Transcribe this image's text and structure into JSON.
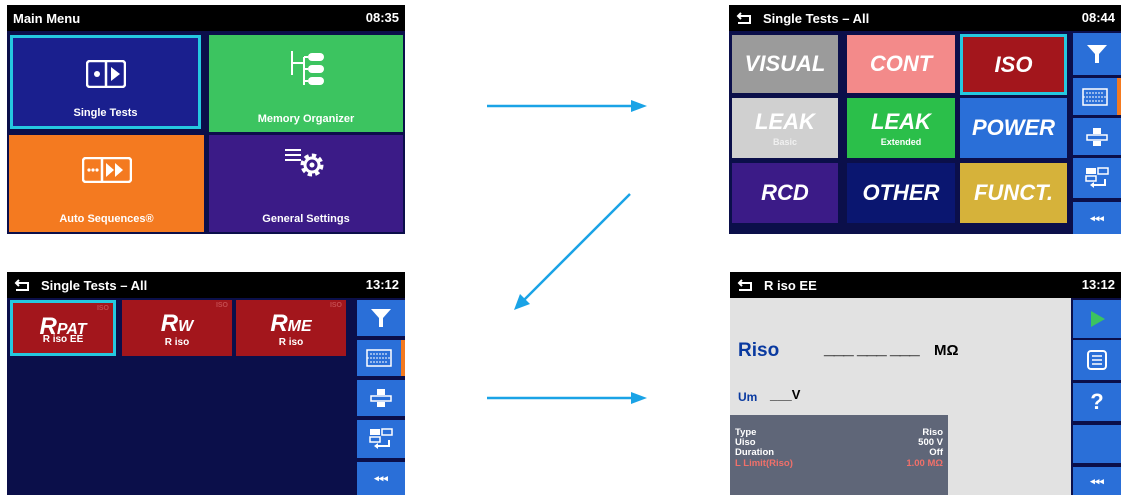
{
  "screen1": {
    "title": "Main Menu",
    "time": "08:35",
    "tiles": [
      {
        "label": "Single Tests",
        "icon": "single-tests-icon"
      },
      {
        "label": "Memory Organizer",
        "icon": "memory-organizer-icon"
      },
      {
        "label": "Auto Sequences®",
        "icon": "auto-sequences-icon"
      },
      {
        "label": "General Settings",
        "icon": "general-settings-icon"
      }
    ],
    "colors": {
      "single": "#1a1f8e",
      "memory": "#3cc460",
      "auto": "#f47a20",
      "settings": "#3b1b87",
      "selected": "#25c8e0"
    }
  },
  "screen2": {
    "title": "Single Tests – All",
    "time": "08:44",
    "tests": [
      {
        "label": "VISUAL",
        "sub": "",
        "color": "#9b9b9b"
      },
      {
        "label": "CONT",
        "sub": "",
        "color": "#f38a8a"
      },
      {
        "label": "ISO",
        "sub": "",
        "color": "#a3161c"
      },
      {
        "label": "LEAK",
        "sub": "Basic",
        "color": "#d0d0d0"
      },
      {
        "label": "LEAK",
        "sub": "Extended",
        "color": "#2bbf4a"
      },
      {
        "label": "POWER",
        "sub": "",
        "color": "#2a6fd8"
      },
      {
        "label": "RCD",
        "sub": "",
        "color": "#3b1b87"
      },
      {
        "label": "OTHER",
        "sub": "",
        "color": "#0a1670"
      },
      {
        "label": "FUNCT.",
        "sub": "",
        "color": "#d6b23a"
      }
    ],
    "sidebar": {
      "more": "◂◂◂"
    }
  },
  "screen3": {
    "title": "Single Tests – All",
    "time": "13:12",
    "tiles": [
      {
        "main": "R",
        "subscript": "PAT",
        "caption": "R iso EE",
        "corner": "ISO"
      },
      {
        "main": "R",
        "subscript": "W",
        "caption": "R iso",
        "corner": "ISO"
      },
      {
        "main": "R",
        "subscript": "ME",
        "caption": "R iso",
        "corner": "ISO"
      }
    ],
    "sidebar": {
      "more": "◂◂◂"
    }
  },
  "screen4": {
    "title": "R iso EE",
    "time": "13:12",
    "result_label": "Riso",
    "result_value": "___ ___ ___",
    "result_unit": "MΩ",
    "um_label": "Um",
    "um_value": "___V",
    "params": [
      {
        "name": "Type",
        "value": "Riso"
      },
      {
        "name": "Uiso",
        "value": "500 V"
      },
      {
        "name": "Duration",
        "value": "Off"
      },
      {
        "name": "L Limit(Riso)",
        "value": "1.00 MΩ"
      }
    ],
    "sidebar": {
      "help": "?",
      "more": "◂◂◂"
    }
  }
}
